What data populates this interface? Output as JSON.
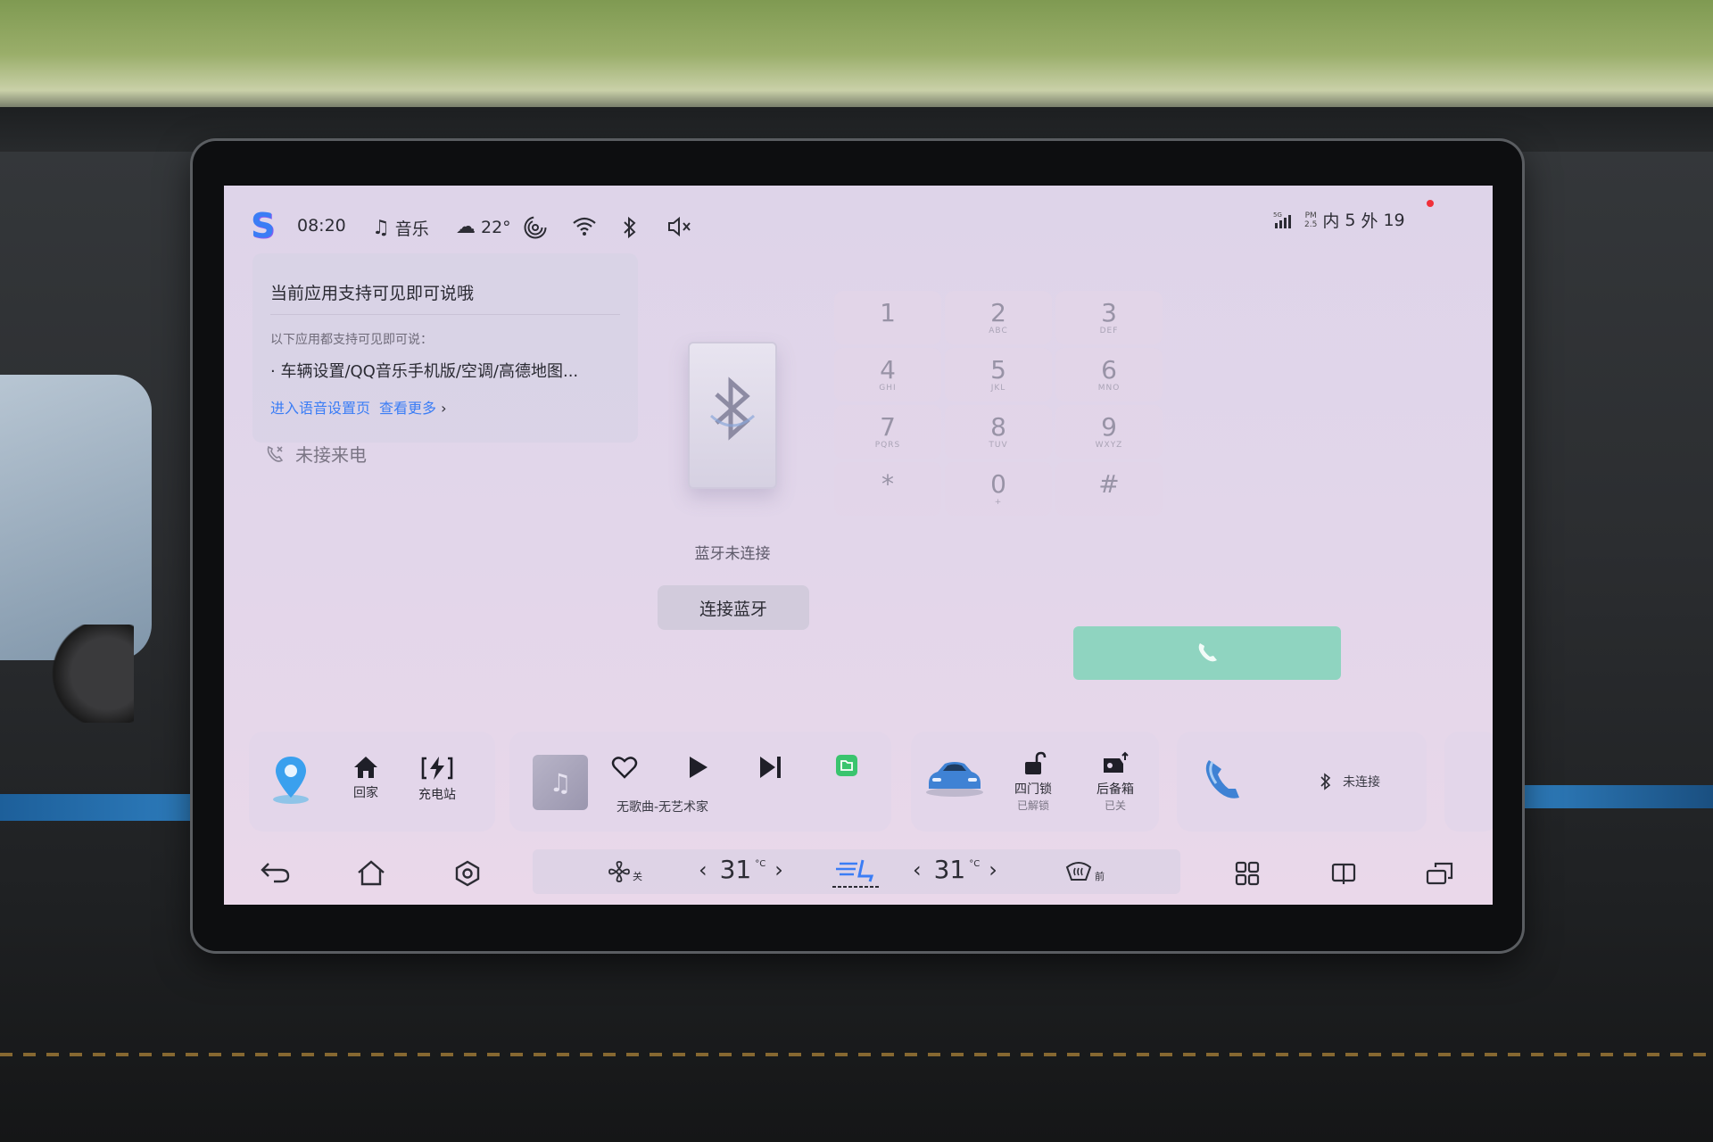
{
  "status_bar": {
    "time": "08:20",
    "music_label": "音乐",
    "temperature": "22°",
    "signal_label": "5G",
    "pm_label": "PM\n2.5",
    "pm_inside_prefix": "内",
    "pm_inside": "5",
    "pm_outside_prefix": "外",
    "pm_outside": "19"
  },
  "voice_tip": {
    "title": "当前应用支持可见即可说哦",
    "subtitle": "以下应用都支持可见即可说：",
    "apps": "· 车辆设置/QQ音乐手机版/空调/高德地图...",
    "link_settings": "进入语音设置页",
    "link_more": "查看更多"
  },
  "missed_calls_label": "未接来电",
  "bluetooth": {
    "status": "蓝牙未连接",
    "connect_button": "连接蓝牙"
  },
  "dialpad": {
    "keys": [
      {
        "num": "1",
        "letters": ""
      },
      {
        "num": "2",
        "letters": "ABC"
      },
      {
        "num": "3",
        "letters": "DEF"
      },
      {
        "num": "4",
        "letters": "GHI"
      },
      {
        "num": "5",
        "letters": "JKL"
      },
      {
        "num": "6",
        "letters": "MNO"
      },
      {
        "num": "7",
        "letters": "PQRS"
      },
      {
        "num": "8",
        "letters": "TUV"
      },
      {
        "num": "9",
        "letters": "WXYZ"
      },
      {
        "num": "*",
        "letters": ""
      },
      {
        "num": "0",
        "letters": "+"
      },
      {
        "num": "#",
        "letters": ""
      }
    ]
  },
  "dock": {
    "home_label": "回家",
    "charging_label": "充电站",
    "song_info": "无歌曲-无艺术家",
    "door_lock_label": "四门锁",
    "door_lock_status": "已解锁",
    "trunk_label": "后备箱",
    "trunk_status": "已关",
    "phone_status": "未连接"
  },
  "climate": {
    "fan_status": "关",
    "left_temp": "31",
    "right_temp": "31",
    "temp_unit": "°C",
    "defrost_label": "前"
  },
  "colors": {
    "accent_blue": "#3b7df5",
    "call_green": "#8fd4c0",
    "screen_bg": "#e0d5ea"
  }
}
